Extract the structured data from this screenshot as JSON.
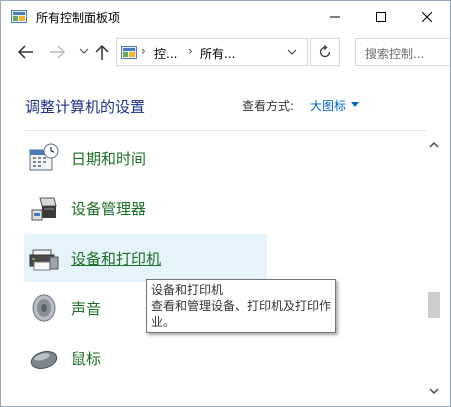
{
  "window": {
    "title": "所有控制面板项"
  },
  "navigation": {
    "address": {
      "segment1": "控...",
      "segment2": "所有...",
      "separator": "›"
    },
    "search": {
      "placeholder": "搜索控制..."
    }
  },
  "header": {
    "heading": "调整计算机的设置",
    "view_by_label": "查看方式:",
    "view_by_value": "大图标"
  },
  "items": [
    {
      "label": "日期和时间",
      "icon": "calendar-clock-icon"
    },
    {
      "label": "设备管理器",
      "icon": "device-manager-icon"
    },
    {
      "label": "设备和打印机",
      "icon": "printer-icon",
      "hovered": true
    },
    {
      "label": "声音",
      "icon": "speaker-icon"
    },
    {
      "label": "鼠标",
      "icon": "mouse-icon"
    }
  ],
  "tooltip": {
    "title": "设备和打印机",
    "description": "查看和管理设备、打印机及打印作业。"
  },
  "colors": {
    "accent": "#0066cc",
    "item_label": "#1d6f25",
    "heading": "#1e3287",
    "hover_bg": "#e5f3fb"
  }
}
